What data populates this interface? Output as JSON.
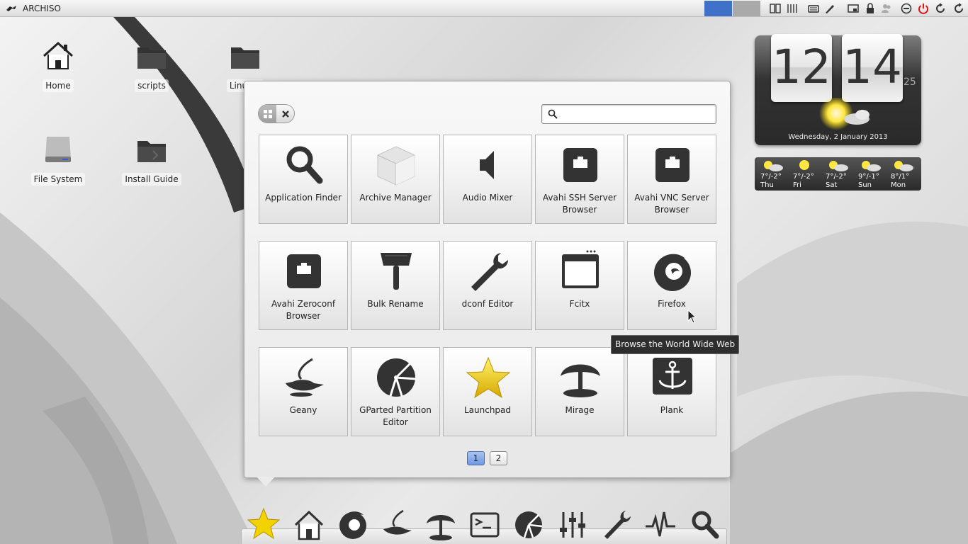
{
  "topbar": {
    "title": "ARCHISO",
    "workspace_colors": [
      "#3f71c9",
      "#a9a9a9"
    ],
    "tray_icons": [
      "clock-tray-icon",
      "calendar-tray-icon",
      "keyboard-icon",
      "pen-icon",
      "display-icon",
      "lock-icon",
      "users-icon",
      "logout-icon",
      "power-icon",
      "restart-icon",
      "refresh-icon"
    ]
  },
  "desktop": {
    "icons": [
      {
        "label": "Home",
        "icon": "home-icon"
      },
      {
        "label": "scripts",
        "icon": "folder-icon"
      },
      {
        "label": "Linux V",
        "icon": "folder-icon"
      },
      {
        "label": "File System",
        "icon": "drive-icon"
      },
      {
        "label": "Install Guide",
        "icon": "folder-icon"
      }
    ]
  },
  "clock": {
    "hours": "12",
    "minutes": "14",
    "seconds": "25",
    "date": "Wednesday, 2 January 2013"
  },
  "weather": [
    {
      "temp": "7°/-2°",
      "day": "Thu"
    },
    {
      "temp": "7°/-2°",
      "day": "Fri"
    },
    {
      "temp": "7°/-2°",
      "day": "Sat"
    },
    {
      "temp": "9°/-1°",
      "day": "Sun"
    },
    {
      "temp": "8°/1°",
      "day": "Mon"
    }
  ],
  "launcher": {
    "search": {
      "value": "",
      "placeholder": ""
    },
    "apps": [
      {
        "name": "Application Finder",
        "icon": "search-icon"
      },
      {
        "name": "Archive Manager",
        "icon": "box-icon"
      },
      {
        "name": "Audio Mixer",
        "icon": "speaker-icon"
      },
      {
        "name": "Avahi SSH Server Browser",
        "icon": "network-port-icon"
      },
      {
        "name": "Avahi VNC Server Browser",
        "icon": "network-port-icon"
      },
      {
        "name": "Avahi Zeroconf Browser",
        "icon": "network-port-icon"
      },
      {
        "name": "Bulk Rename",
        "icon": "hammer-icon"
      },
      {
        "name": "dconf Editor",
        "icon": "wrench-icon"
      },
      {
        "name": "Fcitx",
        "icon": "window-icon"
      },
      {
        "name": "Firefox",
        "icon": "firefox-icon"
      },
      {
        "name": "Geany",
        "icon": "lamp-icon"
      },
      {
        "name": "GParted Partition Editor",
        "icon": "disk-partition-icon"
      },
      {
        "name": "Launchpad",
        "icon": "star-icon"
      },
      {
        "name": "Mirage",
        "icon": "palm-tree-icon"
      },
      {
        "name": "Plank",
        "icon": "anchor-icon"
      }
    ],
    "pages": [
      "1",
      "2"
    ],
    "active_page": "1",
    "tooltip": "Browse the World Wide Web"
  },
  "dock": {
    "items": [
      "star-icon",
      "home-icon",
      "firefox-icon",
      "lamp-icon",
      "palm-tree-icon",
      "terminal-icon",
      "disk-partition-icon",
      "mixer-icon",
      "wrench-icon",
      "pulse-icon",
      "search-icon"
    ]
  }
}
